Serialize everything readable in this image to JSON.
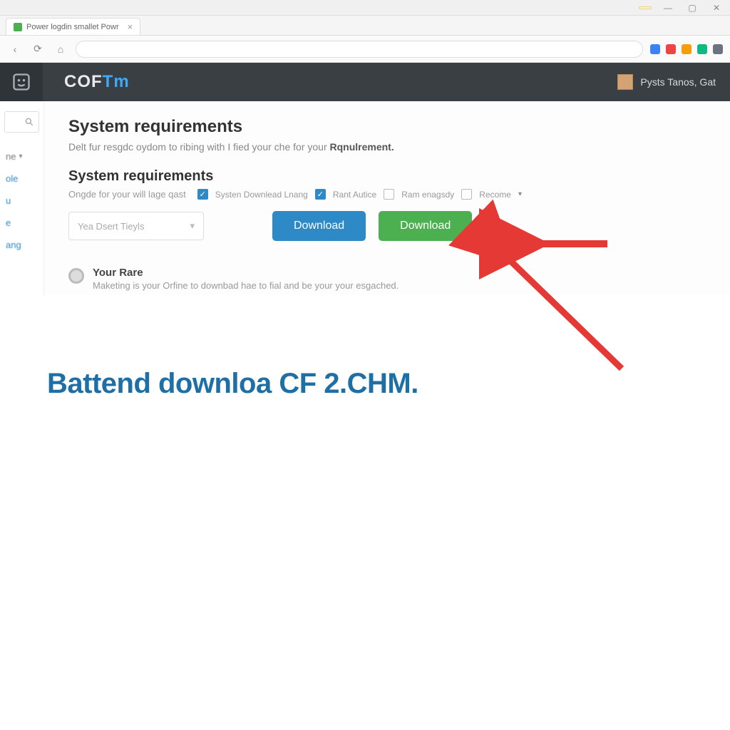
{
  "chrome": {
    "badge": "",
    "tab_title": "Power logdin smallet Powr",
    "minimize": "—",
    "maximize": "▢",
    "close": "✕"
  },
  "header": {
    "brand_a": "COF",
    "brand_b": "Tm",
    "user": "Pysts Tanos, Gat"
  },
  "sidebar": {
    "items": [
      "ne",
      "ole",
      "u",
      "e",
      "ang"
    ]
  },
  "main": {
    "h1": "System requirements",
    "sub_a": "Delt fur resgdc oydom to ribing with I fied your che for your ",
    "sub_b": "Rqnulrement.",
    "h2": "System requirements",
    "opt_lead": "Ongde for your will lage qast",
    "checks": [
      {
        "on": true,
        "label": "Systen Downlead Lnang"
      },
      {
        "on": true,
        "label": "Rant Autice"
      },
      {
        "on": false,
        "label": "Ram enagsdy"
      },
      {
        "on": false,
        "label": "Recome"
      }
    ],
    "dropdown_value": "Yea Dsert Tieyls",
    "btn_blue": "Download",
    "btn_green": "Download",
    "note_title": "Your Rare",
    "note_body": "Maketing is your Orfine to downbad hae to fial and be your your esgached."
  },
  "caption": "Battend downloa CF 2.CHM."
}
